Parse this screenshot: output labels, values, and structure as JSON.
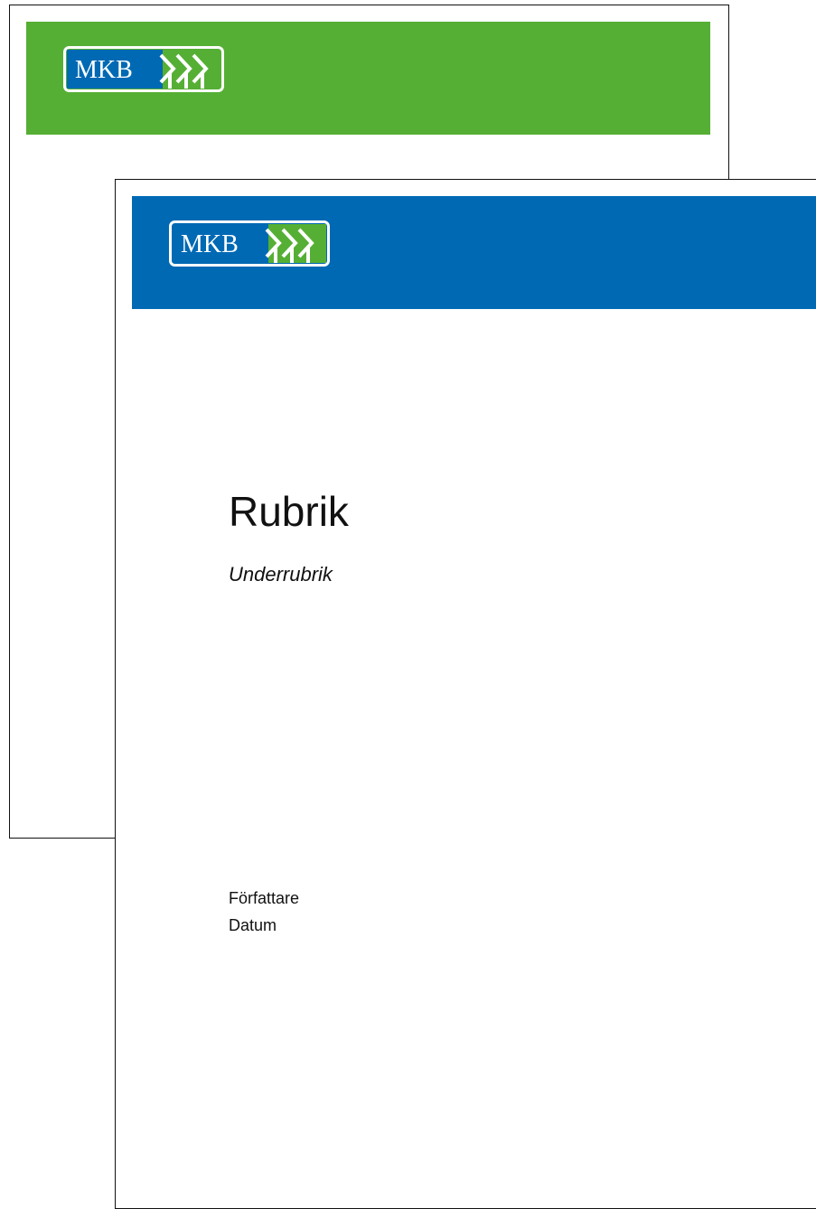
{
  "colors": {
    "back_banner": "#55af34",
    "front_banner": "#0069b4",
    "logo_blue": "#0069b4",
    "logo_green": "#55af34",
    "logo_frame": "#ffffff",
    "border": "#111111",
    "text": "#111111"
  },
  "back_page": {
    "logo": {
      "text": "MKB",
      "icon": "mkb-arrows-icon"
    }
  },
  "front_page": {
    "logo": {
      "text": "MKB",
      "icon": "mkb-arrows-icon"
    },
    "title": "Rubrik",
    "subtitle": "Underrubrik",
    "author": "Författare",
    "date": "Datum"
  }
}
